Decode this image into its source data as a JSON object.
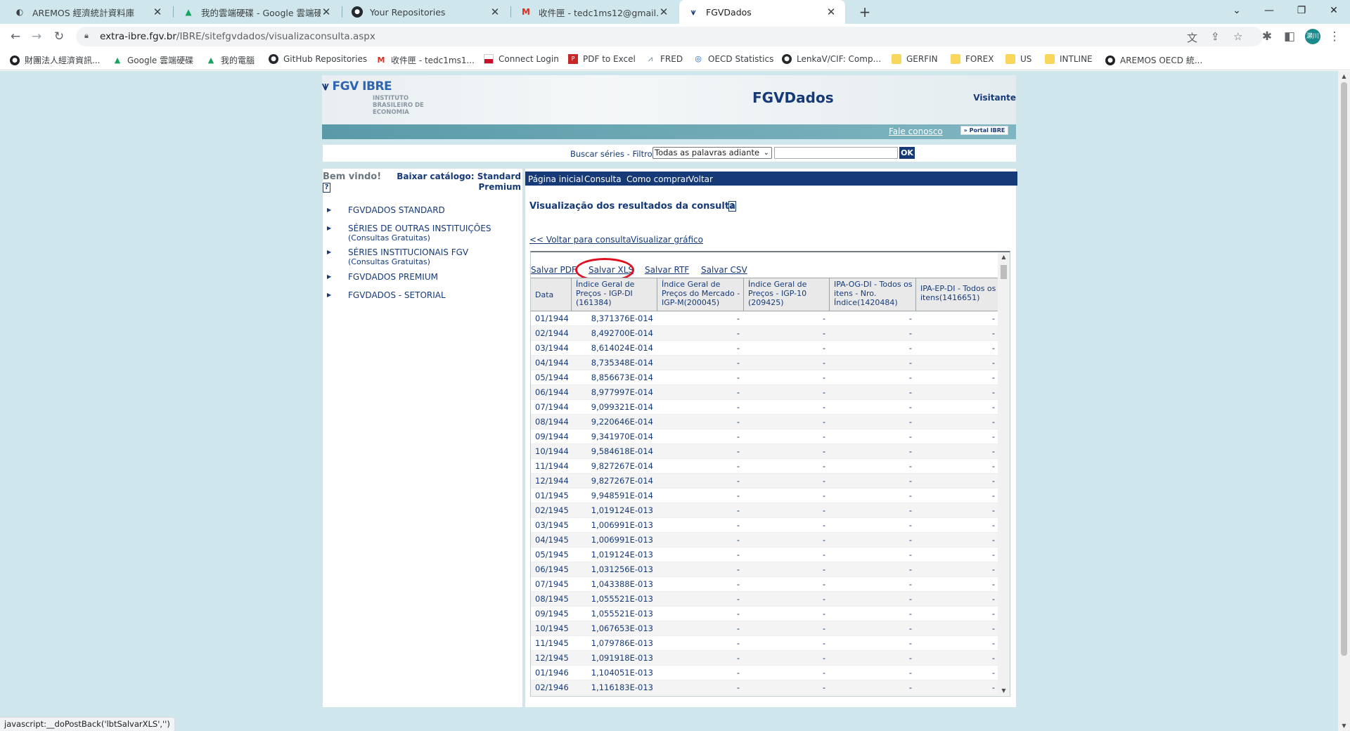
{
  "browser": {
    "tabs": [
      {
        "title": "AREMOS 經濟統計資料庫",
        "icon": "globe-icon"
      },
      {
        "title": "我的雲端硬碟 - Google 雲端硬碟",
        "icon": "drive-icon"
      },
      {
        "title": "Your Repositories",
        "icon": "github-icon"
      },
      {
        "title": "收件匣 - tedc1ms12@gmail.com",
        "icon": "gmail-icon"
      },
      {
        "title": "FGVDados",
        "icon": "fgv-icon"
      }
    ],
    "url_host": "extra-ibre.fgv.br",
    "url_path": "/IBRE/sitefgvdados/visualizaconsulta.aspx",
    "profile_initial": "瀨川",
    "bookmarks": [
      {
        "label": "財團法人經濟資訊...",
        "icon": "globe"
      },
      {
        "label": "Google 雲端硬碟",
        "icon": "drive"
      },
      {
        "label": "我的電腦",
        "icon": "drive"
      },
      {
        "label": "GitHub Repositories",
        "icon": "github"
      },
      {
        "label": "收件匣 - tedc1ms1...",
        "icon": "mail"
      },
      {
        "label": "Connect Login",
        "icon": "flag"
      },
      {
        "label": "PDF to Excel",
        "icon": "pdf"
      },
      {
        "label": "FRED",
        "icon": "chart"
      },
      {
        "label": "OECD Statistics",
        "icon": "oecd"
      },
      {
        "label": "LenkaV/CIF: Comp...",
        "icon": "github"
      },
      {
        "label": "GERFIN",
        "icon": "folder"
      },
      {
        "label": "FOREX",
        "icon": "folder"
      },
      {
        "label": "US",
        "icon": "folder"
      },
      {
        "label": "INTLINE",
        "icon": "folder"
      },
      {
        "label": "AREMOS OECD 統...",
        "icon": "globe"
      }
    ],
    "status_text": "javascript:__doPostBack('lbtSalvarXLS','')"
  },
  "site": {
    "logo_mark_1": "FGV",
    "logo_mark_2": "IBRE",
    "logo_sub": "INSTITUTO BRASILEIRO DE ECONOMIA",
    "title": "FGVDados",
    "visitor": "Visitante",
    "contact_link": "Fale conosco",
    "portal_button": "» Portal IBRE",
    "search_label": "Buscar séries - Filtro:",
    "filter_value": "Todas as palavras adiante",
    "ok_label": "OK"
  },
  "left": {
    "welcome": "Bem vindo!",
    "help": "?",
    "catalog_label": "Baixar catálogo:",
    "catalog_standard": "Standard",
    "catalog_premium": "Premium",
    "nav": [
      {
        "label": "FGVDADOS STANDARD",
        "sub": ""
      },
      {
        "label": "SÉRIES DE OUTRAS INSTITUIÇÕES",
        "sub": "(Consultas Gratuitas)"
      },
      {
        "label": "SÉRIES INSTITUCIONAIS FGV",
        "sub": "(Consultas Gratuitas)"
      },
      {
        "label": "FGVDADOS PREMIUM",
        "sub": ""
      },
      {
        "label": "FGVDADOS - SETORIAL",
        "sub": ""
      }
    ]
  },
  "right": {
    "topnav": [
      "Página inicial",
      "Consulta",
      "Como comprar",
      "Voltar"
    ],
    "results_title": "Visualização dos resultados da consulta",
    "help": "?",
    "back_link": "<< Voltar para consulta",
    "chart_link": "Visualizar gráfico",
    "saves": [
      "Salvar PDF",
      "Salvar XLS",
      "Salvar RTF",
      "Salvar CSV"
    ]
  },
  "table": {
    "headers": [
      "Data",
      "Índice Geral de Preços - IGP-DI (161384)",
      "Índice Geral de Preços do Mercado - IGP-M(200045)",
      "Índice Geral de Preços - IGP-10 (209425)",
      "IPA-OG-DI - Todos os itens - Nro. Índice(1420484)",
      "IPA-EP-DI - Todos os itens(1416651)"
    ],
    "rows": [
      [
        "01/1944",
        "8,371376E-014",
        "-",
        "-",
        "-",
        "-"
      ],
      [
        "02/1944",
        "8,492700E-014",
        "-",
        "-",
        "-",
        "-"
      ],
      [
        "03/1944",
        "8,614024E-014",
        "-",
        "-",
        "-",
        "-"
      ],
      [
        "04/1944",
        "8,735348E-014",
        "-",
        "-",
        "-",
        "-"
      ],
      [
        "05/1944",
        "8,856673E-014",
        "-",
        "-",
        "-",
        "-"
      ],
      [
        "06/1944",
        "8,977997E-014",
        "-",
        "-",
        "-",
        "-"
      ],
      [
        "07/1944",
        "9,099321E-014",
        "-",
        "-",
        "-",
        "-"
      ],
      [
        "08/1944",
        "9,220646E-014",
        "-",
        "-",
        "-",
        "-"
      ],
      [
        "09/1944",
        "9,341970E-014",
        "-",
        "-",
        "-",
        "-"
      ],
      [
        "10/1944",
        "9,584618E-014",
        "-",
        "-",
        "-",
        "-"
      ],
      [
        "11/1944",
        "9,827267E-014",
        "-",
        "-",
        "-",
        "-"
      ],
      [
        "12/1944",
        "9,827267E-014",
        "-",
        "-",
        "-",
        "-"
      ],
      [
        "01/1945",
        "9,948591E-014",
        "-",
        "-",
        "-",
        "-"
      ],
      [
        "02/1945",
        "1,019124E-013",
        "-",
        "-",
        "-",
        "-"
      ],
      [
        "03/1945",
        "1,006991E-013",
        "-",
        "-",
        "-",
        "-"
      ],
      [
        "04/1945",
        "1,006991E-013",
        "-",
        "-",
        "-",
        "-"
      ],
      [
        "05/1945",
        "1,019124E-013",
        "-",
        "-",
        "-",
        "-"
      ],
      [
        "06/1945",
        "1,031256E-013",
        "-",
        "-",
        "-",
        "-"
      ],
      [
        "07/1945",
        "1,043388E-013",
        "-",
        "-",
        "-",
        "-"
      ],
      [
        "08/1945",
        "1,055521E-013",
        "-",
        "-",
        "-",
        "-"
      ],
      [
        "09/1945",
        "1,055521E-013",
        "-",
        "-",
        "-",
        "-"
      ],
      [
        "10/1945",
        "1,067653E-013",
        "-",
        "-",
        "-",
        "-"
      ],
      [
        "11/1945",
        "1,079786E-013",
        "-",
        "-",
        "-",
        "-"
      ],
      [
        "12/1945",
        "1,091918E-013",
        "-",
        "-",
        "-",
        "-"
      ],
      [
        "01/1946",
        "1,104051E-013",
        "-",
        "-",
        "-",
        "-"
      ],
      [
        "02/1946",
        "1,116183E-013",
        "-",
        "-",
        "-",
        "-"
      ]
    ]
  },
  "colors": {
    "brand_navy": "#163a78",
    "page_background": "#cfe6ec",
    "tabstrip": "#cfe7ec",
    "teal_bar": "#5a9aa8",
    "highlight_ring": "#e0101e"
  }
}
